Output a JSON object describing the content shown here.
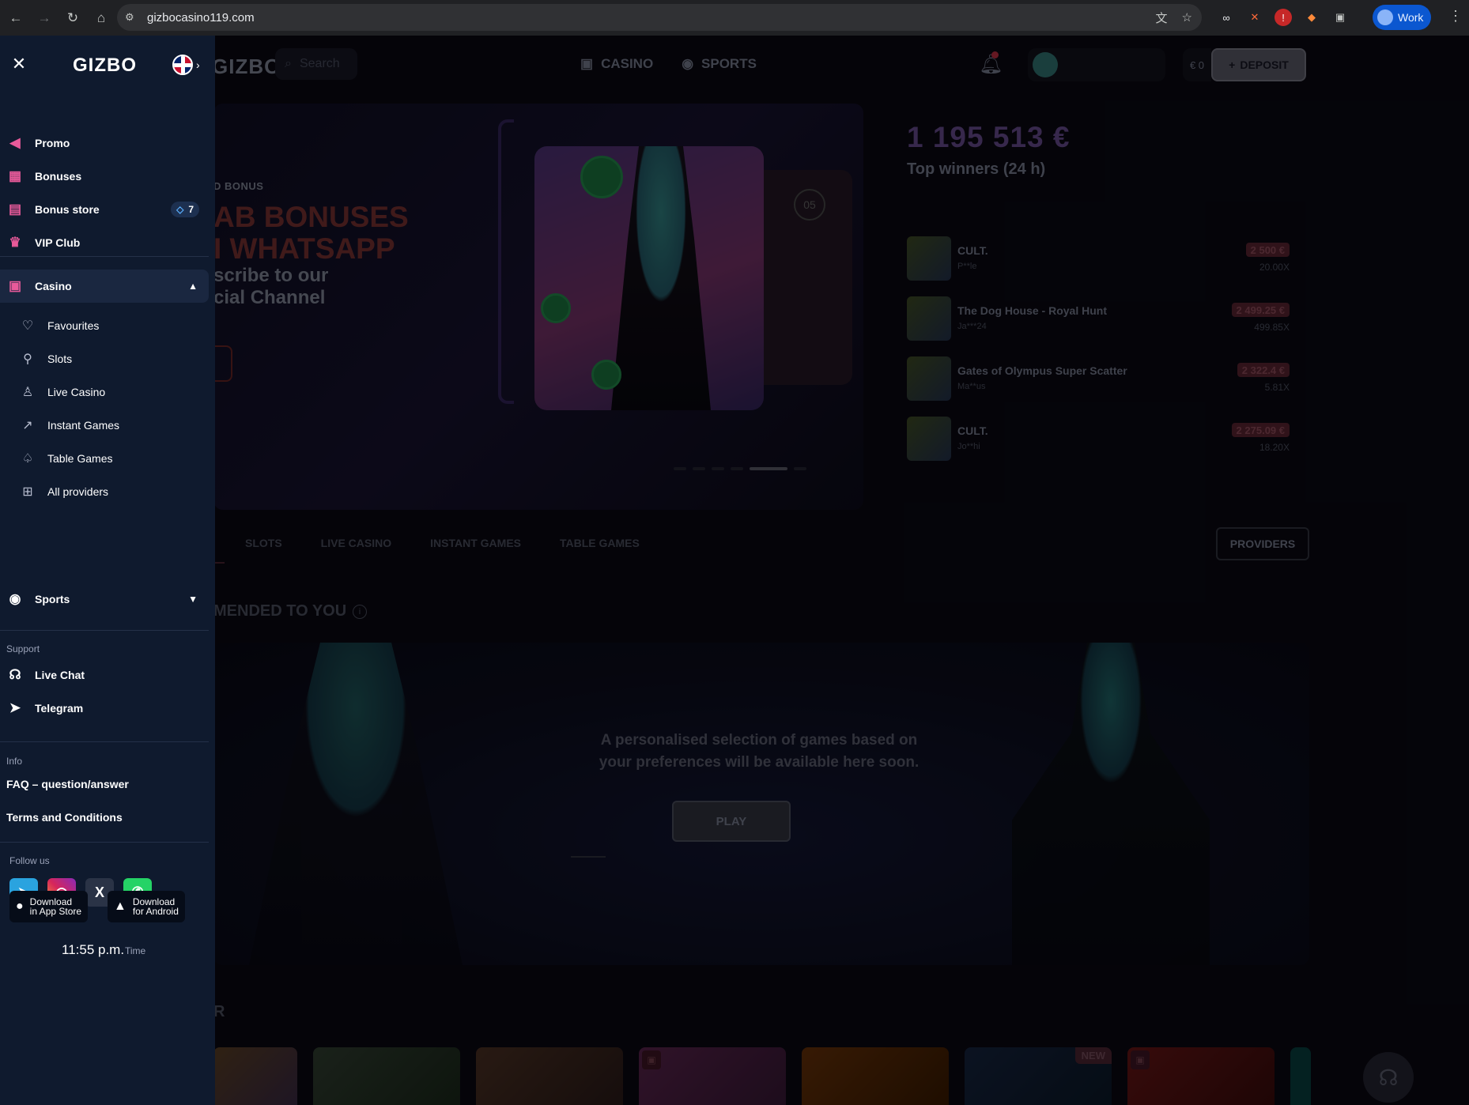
{
  "browser": {
    "url": "gizbocasino119.com",
    "profile_label": "Work"
  },
  "site": {
    "logo_text": "GIZBO",
    "search_placeholder": "Search",
    "nav": [
      "CASINO",
      "SPORTS"
    ],
    "balance": "€ 0",
    "deposit_label": "DEPOSIT",
    "hero": {
      "kicker": "D BONUS",
      "headline_1": "AB BONUSES",
      "headline_2": "I WHATSAPP",
      "sub_1": "scribe to our",
      "sub_2": "cial Channel",
      "next_card_number": "05",
      "active_slide": 5,
      "slide_count": 6
    },
    "winners": {
      "total": "1 195 513 €",
      "title": "Top winners (24 h)",
      "rows": [
        {
          "game": "CULT.",
          "user": "P**le",
          "amount": "2 500 €",
          "mult": "20.00X"
        },
        {
          "game": "The Dog House - Royal Hunt",
          "user": "Ja***24",
          "amount": "2 499.25 €",
          "mult": "499.85X"
        },
        {
          "game": "Gates of Olympus Super Scatter",
          "user": "Ma**us",
          "amount": "2 322.4 €",
          "mult": "5.81X"
        },
        {
          "game": "CULT.",
          "user": "Jo**hi",
          "amount": "2 275.09 €",
          "mult": "18.20X"
        }
      ]
    },
    "tabs": [
      "SLOTS",
      "LIVE CASINO",
      "INSTANT GAMES",
      "TABLE GAMES"
    ],
    "providers_label": "PROVIDERS",
    "recommended_title": "MENDED TO YOU",
    "recommended_text": "A personalised selection of games based on your preferences will be available here soon.",
    "play_label": "PLAY",
    "popular_title": "R",
    "game_badge_new": "NEW"
  },
  "drawer": {
    "logo": "GIZBO",
    "top_items": [
      {
        "label": "Promo",
        "icon": "megaphone-icon"
      },
      {
        "label": "Bonuses",
        "icon": "gift-icon"
      },
      {
        "label": "Bonus store",
        "icon": "store-icon",
        "badge": "7"
      },
      {
        "label": "VIP Club",
        "icon": "crown-icon"
      }
    ],
    "casino_label": "Casino",
    "casino_items": [
      {
        "label": "Favourites",
        "icon": "heart-icon"
      },
      {
        "label": "Slots",
        "icon": "cherries-icon"
      },
      {
        "label": "Live Casino",
        "icon": "person-icon"
      },
      {
        "label": "Instant Games",
        "icon": "chart-icon"
      },
      {
        "label": "Table Games",
        "icon": "spade-icon"
      },
      {
        "label": "All providers",
        "icon": "grid-icon"
      }
    ],
    "sports_label": "Sports",
    "support_label": "Support",
    "support_items": [
      {
        "label": "Live Chat",
        "icon": "headset-icon"
      },
      {
        "label": "Telegram",
        "icon": "telegram-icon"
      }
    ],
    "info_label": "Info",
    "info_items": [
      "FAQ – question/answer",
      "Terms and Conditions"
    ],
    "follow_label": "Follow us",
    "download_ios_1": "Download",
    "download_ios_2": "in App Store",
    "download_android_1": "Download",
    "download_android_2": "for Android",
    "time": "11:55 p.m.",
    "time_label": "Time"
  },
  "colors": {
    "drawer_bg": "#0f1a2e",
    "accent_pink": "#e85a9a",
    "telegram": "#2aa3df",
    "whatsapp": "#25d366"
  }
}
